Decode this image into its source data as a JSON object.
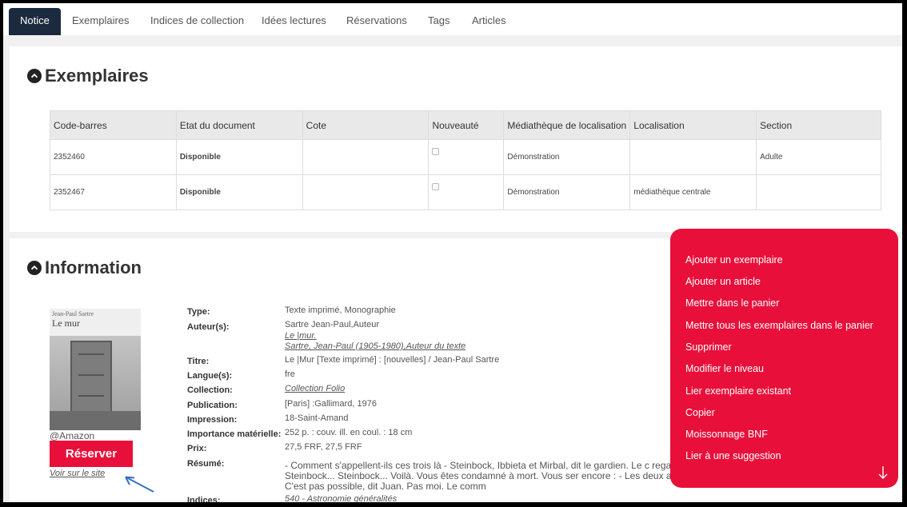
{
  "tabs": [
    "Notice",
    "Exemplaires",
    "Indices de collection",
    "Idées lectures",
    "Réservations",
    "Tags",
    "Articles"
  ],
  "exemplaires": {
    "title": "Exemplaires",
    "columns": [
      "Code-barres",
      "Etat du document",
      "Cote",
      "Nouveauté",
      "Médiathèque de localisation",
      "Localisation",
      "Section"
    ],
    "rows": [
      {
        "code": "2352460",
        "etat": "Disponible",
        "cote": "",
        "mediatheque": "Démonstration",
        "localisation": "",
        "section": "Adulte"
      },
      {
        "code": "2352467",
        "etat": "Disponible",
        "cote": "",
        "mediatheque": "Démonstration",
        "localisation": "médiathèque centrale",
        "section": ""
      }
    ]
  },
  "information": {
    "title": "Information",
    "cover": {
      "author": "Jean-Paul Sartre",
      "title": "Le mur"
    },
    "amazon": "@Amazon",
    "reserve": "Réserver",
    "voir": "Voir sur le site",
    "labels": {
      "type": "Type:",
      "auteurs": "Auteur(s):",
      "titre": "Titre:",
      "langue": "Langue(s):",
      "collection": "Collection:",
      "publication": "Publication:",
      "impression": "Impression:",
      "importance": "Importance matérielle:",
      "prix": "Prix:",
      "resume": "Résumé:",
      "indices": "Indices:"
    },
    "values": {
      "type": "Texte imprimé, Monographie",
      "auteur1": "Sartre Jean-Paul,Auteur",
      "auteur2": "Le |mur.",
      "auteur3": "Sartre, Jean-Paul (1905-1980),Auteur du texte",
      "titre": "Le |Mur [Texte imprimé] : [nouvelles] / Jean-Paul Sartre",
      "langue": "fre",
      "collection": "Collection Folio",
      "publication": "[Paris] :Gallimard, 1976",
      "impression": "18-Saint-Amand",
      "importance": "252 p. : couv. ill. en coul. : 18 cm",
      "prix": "27,5 FRF, 27,5 FRF",
      "resume": "- Comment s'appellent-ils ces trois là - Steinbock, Ibbieta et Mirbal, dit le gardien. Le c regarda sa liste : - Steinbock... Steinbock... Voilà. Vous êtes condamné à mort. Vous ser encore : - Les deux autres aussi, dit-il. - C'est pas possible, dit Juan. Pas moi. Le comm",
      "indices": "540 - Astronomie généralités"
    }
  },
  "menu": {
    "items": [
      "Ajouter un exemplaire",
      "Ajouter un article",
      "Mettre dans le panier",
      "Mettre tous les exemplaires dans le panier",
      "Supprimer",
      "Modifier le niveau",
      "Lier exemplaire existant",
      "Copier",
      "Moissonnage BNF",
      "Lier à une suggestion"
    ]
  },
  "colors": {
    "accent": "#e8103a",
    "tab_active": "#1c2a3f",
    "available": "#1f7a1f"
  }
}
